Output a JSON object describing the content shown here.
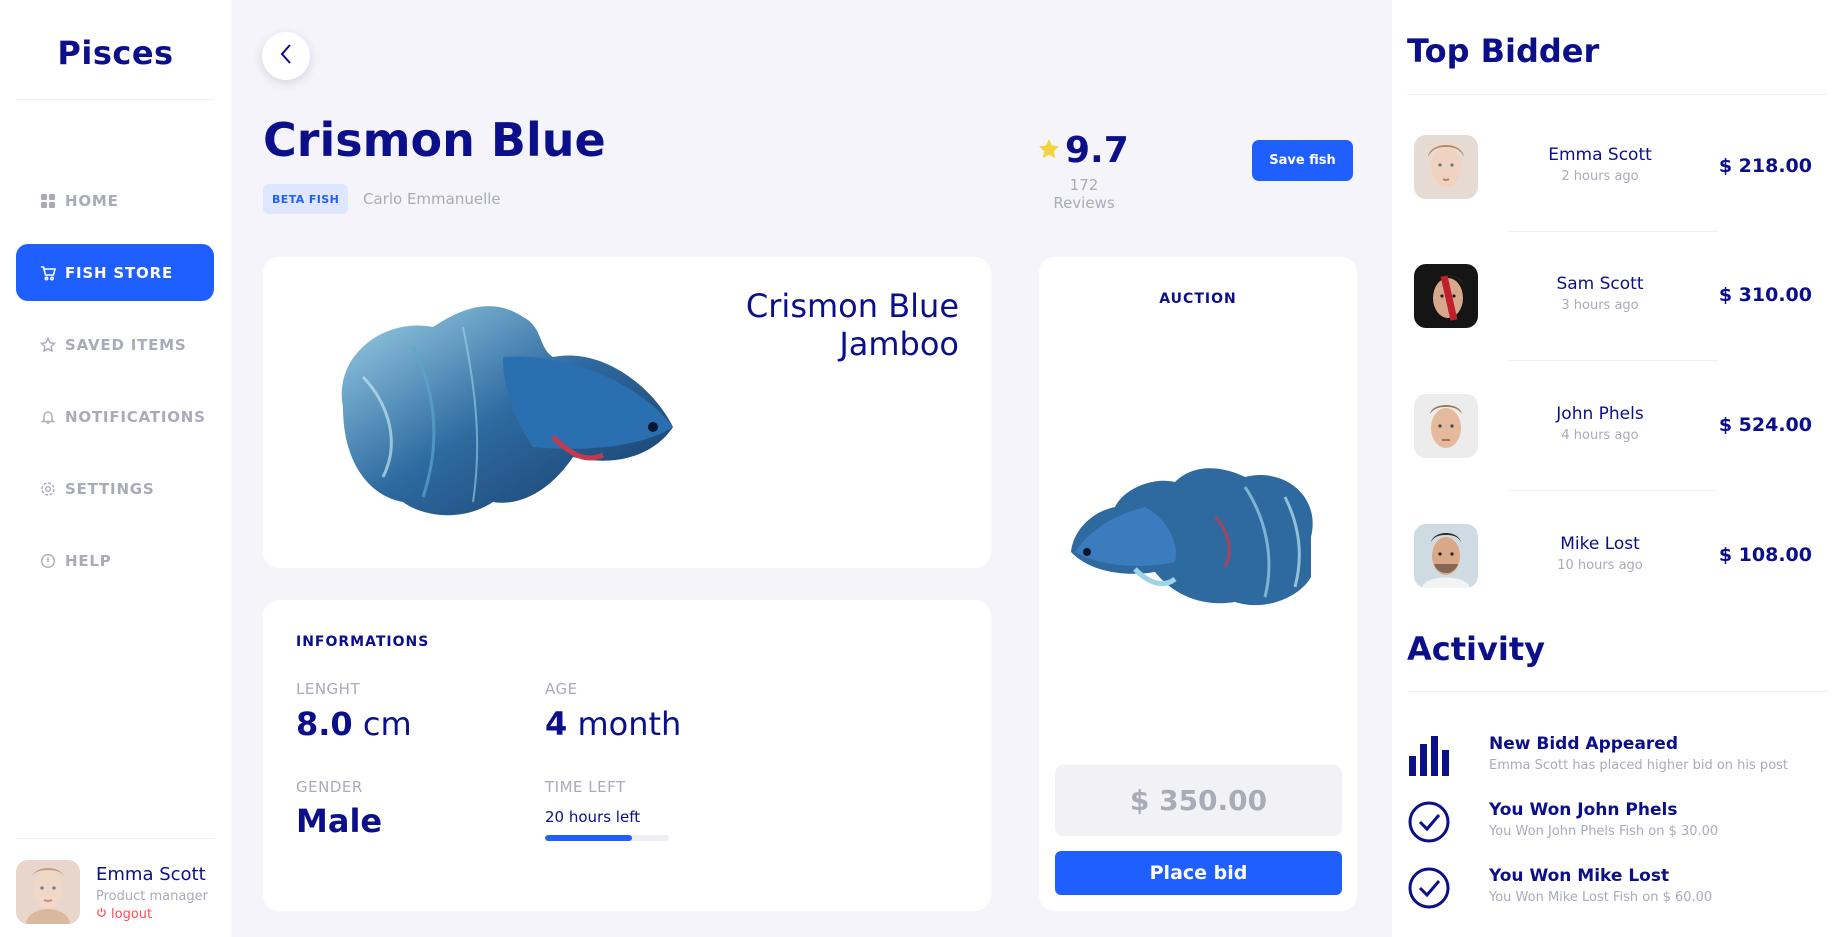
{
  "sidebar": {
    "logo": "Pisces",
    "items": [
      {
        "label": "HOME",
        "icon": "grid-icon"
      },
      {
        "label": "FISH STORE",
        "icon": "cart-icon",
        "active": true
      },
      {
        "label": "SAVED ITEMS",
        "icon": "star-icon"
      },
      {
        "label": "NOTIFICATIONS",
        "icon": "bell-icon"
      },
      {
        "label": "SETTINGS",
        "icon": "gear-icon"
      },
      {
        "label": "HELP",
        "icon": "info-icon"
      }
    ],
    "profile": {
      "name": "Emma Scott",
      "role": "Product manager",
      "logout": "logout"
    }
  },
  "header": {
    "title": "Crismon Blue",
    "badge": "BETA FISH",
    "author": "Carlo Emmanuelle",
    "rating": "9.7",
    "reviews": "172 Reviews",
    "save_label": "Save fish"
  },
  "hero": {
    "name_line1": "Crismon Blue",
    "name_line2": "Jamboo"
  },
  "info": {
    "title": "INFORMATIONS",
    "length_label": "LENGHT",
    "length_value": "8.0",
    "length_unit": "cm",
    "age_label": "AGE",
    "age_value": "4",
    "age_unit": "month",
    "gender_label": "GENDER",
    "gender_value": "Male",
    "time_label": "TIME LEFT",
    "time_value": "20 hours left",
    "time_progress": 0.7
  },
  "auction": {
    "title": "AUCTION",
    "price": "$ 350.00",
    "bid_label": "Place bid"
  },
  "top_bidder": {
    "title": "Top Bidder",
    "bidders": [
      {
        "name": "Emma Scott",
        "time": "2 hours ago",
        "amount": "$ 218.00"
      },
      {
        "name": "Sam Scott",
        "time": "3 hours ago",
        "amount": "$ 310.00"
      },
      {
        "name": "John Phels",
        "time": "4 hours ago",
        "amount": "$ 524.00"
      },
      {
        "name": "Mike Lost",
        "time": "10 hours ago",
        "amount": "$ 108.00"
      }
    ]
  },
  "activity": {
    "title": "Activity",
    "items": [
      {
        "title": "New Bidd Appeared",
        "sub": "Emma Scott has placed higher bid on his post",
        "icon": "bar-chart-icon"
      },
      {
        "title": "You Won John Phels",
        "sub": "You Won John Phels Fish on $ 30.00",
        "icon": "check-circle-icon"
      },
      {
        "title": "You Won Mike Lost",
        "sub": "You Won Mike Lost Fish on $ 60.00",
        "icon": "check-circle-icon"
      }
    ]
  },
  "colors": {
    "accent": "#1f5eff",
    "navy": "#0b0f8a",
    "muted": "#a9abb8",
    "star": "#f5d33d",
    "danger": "#ff4a55"
  }
}
